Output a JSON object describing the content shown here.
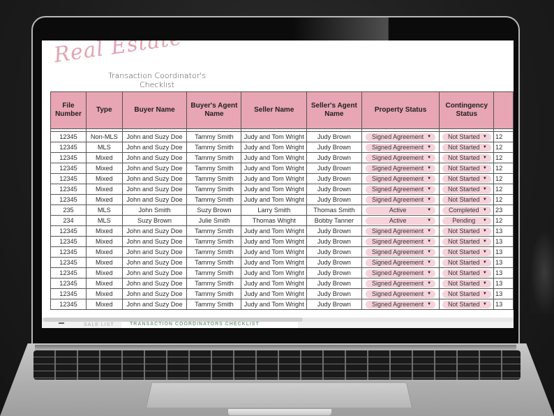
{
  "document": {
    "title_script": "Real Estate",
    "subtitle_line1": "Transaction Coordinator's",
    "subtitle_line2": "Checklist"
  },
  "table": {
    "columns": [
      "File Number",
      "Type",
      "Buyer Name",
      "Buyer's Agent Name",
      "Seller Name",
      "Seller's Agent Name",
      "Property Status",
      "Contingency Status",
      ""
    ],
    "rows": [
      {
        "file": "12345",
        "type": "Non-MLS",
        "buyer": "John and Suzy Doe",
        "buyer_agent": "Tammy Smith",
        "seller": "Judy and Tom Wright",
        "seller_agent": "Judy Brown",
        "property_status": "Signed Agreement",
        "contingency_status": "Not Started",
        "next": "12"
      },
      {
        "file": "12345",
        "type": "MLS",
        "buyer": "John and Suzy Doe",
        "buyer_agent": "Tammy Smith",
        "seller": "Judy and Tom Wright",
        "seller_agent": "Judy Brown",
        "property_status": "Signed Agreement",
        "contingency_status": "Not Started",
        "next": "12"
      },
      {
        "file": "12345",
        "type": "Mixed",
        "buyer": "John and Suzy Doe",
        "buyer_agent": "Tammy Smith",
        "seller": "Judy and Tom Wright",
        "seller_agent": "Judy Brown",
        "property_status": "Signed Agreement",
        "contingency_status": "Not Started",
        "next": "12"
      },
      {
        "file": "12345",
        "type": "Mixed",
        "buyer": "John and Suzy Doe",
        "buyer_agent": "Tammy Smith",
        "seller": "Judy and Tom Wright",
        "seller_agent": "Judy Brown",
        "property_status": "Signed Agreement",
        "contingency_status": "Not Started",
        "next": "12"
      },
      {
        "file": "12345",
        "type": "Mixed",
        "buyer": "John and Suzy Doe",
        "buyer_agent": "Tammy Smith",
        "seller": "Judy and Tom Wright",
        "seller_agent": "Judy Brown",
        "property_status": "Signed Agreement",
        "contingency_status": "Not Started",
        "next": "12"
      },
      {
        "file": "12345",
        "type": "Mixed",
        "buyer": "John and Suzy Doe",
        "buyer_agent": "Tammy Smith",
        "seller": "Judy and Tom Wright",
        "seller_agent": "Judy Brown",
        "property_status": "Signed Agreement",
        "contingency_status": "Not Started",
        "next": "12"
      },
      {
        "file": "12345",
        "type": "Mixed",
        "buyer": "John and Suzy Doe",
        "buyer_agent": "Tammy Smith",
        "seller": "Judy and Tom Wright",
        "seller_agent": "Judy Brown",
        "property_status": "Signed Agreement",
        "contingency_status": "Not Started",
        "next": "12"
      },
      {
        "file": "235",
        "type": "MLS",
        "buyer": "John Smith",
        "buyer_agent": "Suzy Brown",
        "seller": "Larry Smith",
        "seller_agent": "Thomas Smith",
        "property_status": "Active",
        "contingency_status": "Completed",
        "next": "23"
      },
      {
        "file": "234",
        "type": "MLS",
        "buyer": "Suzy Brown",
        "buyer_agent": "Julie Smith",
        "seller": "Thomas Wright",
        "seller_agent": "Bobby Tanner",
        "property_status": "Active",
        "contingency_status": "Pending",
        "next": "12"
      },
      {
        "file": "12345",
        "type": "Mixed",
        "buyer": "John and Suzy Doe",
        "buyer_agent": "Tammy Smith",
        "seller": "Judy and Tom Wright",
        "seller_agent": "Judy Brown",
        "property_status": "Signed Agreement",
        "contingency_status": "Not Started",
        "next": "13"
      },
      {
        "file": "12345",
        "type": "Mixed",
        "buyer": "John and Suzy Doe",
        "buyer_agent": "Tammy Smith",
        "seller": "Judy and Tom Wright",
        "seller_agent": "Judy Brown",
        "property_status": "Signed Agreement",
        "contingency_status": "Not Started",
        "next": "13"
      },
      {
        "file": "12345",
        "type": "Mixed",
        "buyer": "John and Suzy Doe",
        "buyer_agent": "Tammy Smith",
        "seller": "Judy and Tom Wright",
        "seller_agent": "Judy Brown",
        "property_status": "Signed Agreement",
        "contingency_status": "Not Started",
        "next": "13"
      },
      {
        "file": "12345",
        "type": "Mixed",
        "buyer": "John and Suzy Doe",
        "buyer_agent": "Tammy Smith",
        "seller": "Judy and Tom Wright",
        "seller_agent": "Judy Brown",
        "property_status": "Signed Agreement",
        "contingency_status": "Not Started",
        "next": "13"
      },
      {
        "file": "12345",
        "type": "Mixed",
        "buyer": "John and Suzy Doe",
        "buyer_agent": "Tammy Smith",
        "seller": "Judy and Tom Wright",
        "seller_agent": "Judy Brown",
        "property_status": "Signed Agreement",
        "contingency_status": "Not Started",
        "next": "13"
      },
      {
        "file": "12345",
        "type": "Mixed",
        "buyer": "John and Suzy Doe",
        "buyer_agent": "Tammy Smith",
        "seller": "Judy and Tom Wright",
        "seller_agent": "Judy Brown",
        "property_status": "Signed Agreement",
        "contingency_status": "Not Started",
        "next": "13"
      },
      {
        "file": "12345",
        "type": "Mixed",
        "buyer": "John and Suzy Doe",
        "buyer_agent": "Tammy Smith",
        "seller": "Judy and Tom Wright",
        "seller_agent": "Judy Brown",
        "property_status": "Signed Agreement",
        "contingency_status": "Not Started",
        "next": "13"
      },
      {
        "file": "12345",
        "type": "Mixed",
        "buyer": "John and Suzy Doe",
        "buyer_agent": "Tammy Smith",
        "seller": "Judy and Tom Wright",
        "seller_agent": "Judy Brown",
        "property_status": "Signed Agreement",
        "contingency_status": "Not Started",
        "next": "13"
      }
    ]
  },
  "sheet_tabs": {
    "tab1": "SALE LIST",
    "tab2": "TRANSACTION COORDINATORS CHECKLIST"
  },
  "icons": {
    "dropdown": "▼",
    "sheet_menu": "menu-icon"
  },
  "colors": {
    "header_pink": "#e8a5b4",
    "chip_pink": "#f6d2da",
    "script_pink": "#e3a3b3"
  }
}
